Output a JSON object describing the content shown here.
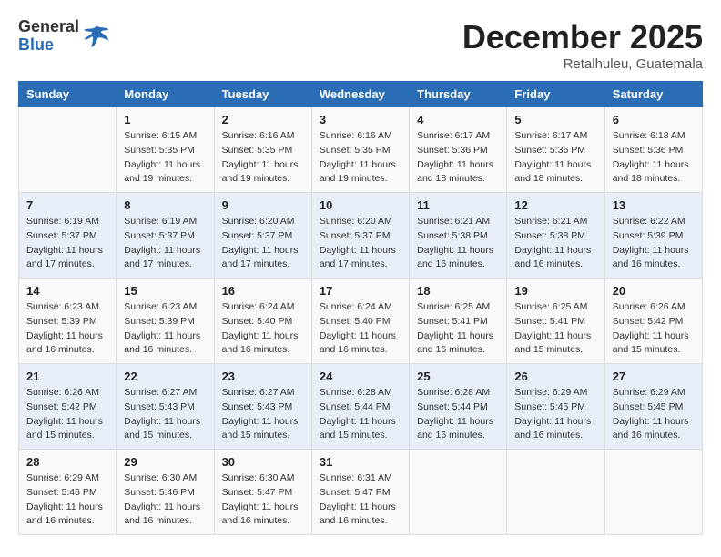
{
  "header": {
    "logo_general": "General",
    "logo_blue": "Blue",
    "month_title": "December 2025",
    "subtitle": "Retalhuleu, Guatemala"
  },
  "days_of_week": [
    "Sunday",
    "Monday",
    "Tuesday",
    "Wednesday",
    "Thursday",
    "Friday",
    "Saturday"
  ],
  "weeks": [
    [
      {
        "day": "",
        "info": ""
      },
      {
        "day": "1",
        "info": "Sunrise: 6:15 AM\nSunset: 5:35 PM\nDaylight: 11 hours and 19 minutes."
      },
      {
        "day": "2",
        "info": "Sunrise: 6:16 AM\nSunset: 5:35 PM\nDaylight: 11 hours and 19 minutes."
      },
      {
        "day": "3",
        "info": "Sunrise: 6:16 AM\nSunset: 5:35 PM\nDaylight: 11 hours and 19 minutes."
      },
      {
        "day": "4",
        "info": "Sunrise: 6:17 AM\nSunset: 5:36 PM\nDaylight: 11 hours and 18 minutes."
      },
      {
        "day": "5",
        "info": "Sunrise: 6:17 AM\nSunset: 5:36 PM\nDaylight: 11 hours and 18 minutes."
      },
      {
        "day": "6",
        "info": "Sunrise: 6:18 AM\nSunset: 5:36 PM\nDaylight: 11 hours and 18 minutes."
      }
    ],
    [
      {
        "day": "7",
        "info": "Sunrise: 6:19 AM\nSunset: 5:37 PM\nDaylight: 11 hours and 17 minutes."
      },
      {
        "day": "8",
        "info": "Sunrise: 6:19 AM\nSunset: 5:37 PM\nDaylight: 11 hours and 17 minutes."
      },
      {
        "day": "9",
        "info": "Sunrise: 6:20 AM\nSunset: 5:37 PM\nDaylight: 11 hours and 17 minutes."
      },
      {
        "day": "10",
        "info": "Sunrise: 6:20 AM\nSunset: 5:37 PM\nDaylight: 11 hours and 17 minutes."
      },
      {
        "day": "11",
        "info": "Sunrise: 6:21 AM\nSunset: 5:38 PM\nDaylight: 11 hours and 16 minutes."
      },
      {
        "day": "12",
        "info": "Sunrise: 6:21 AM\nSunset: 5:38 PM\nDaylight: 11 hours and 16 minutes."
      },
      {
        "day": "13",
        "info": "Sunrise: 6:22 AM\nSunset: 5:39 PM\nDaylight: 11 hours and 16 minutes."
      }
    ],
    [
      {
        "day": "14",
        "info": "Sunrise: 6:23 AM\nSunset: 5:39 PM\nDaylight: 11 hours and 16 minutes."
      },
      {
        "day": "15",
        "info": "Sunrise: 6:23 AM\nSunset: 5:39 PM\nDaylight: 11 hours and 16 minutes."
      },
      {
        "day": "16",
        "info": "Sunrise: 6:24 AM\nSunset: 5:40 PM\nDaylight: 11 hours and 16 minutes."
      },
      {
        "day": "17",
        "info": "Sunrise: 6:24 AM\nSunset: 5:40 PM\nDaylight: 11 hours and 16 minutes."
      },
      {
        "day": "18",
        "info": "Sunrise: 6:25 AM\nSunset: 5:41 PM\nDaylight: 11 hours and 16 minutes."
      },
      {
        "day": "19",
        "info": "Sunrise: 6:25 AM\nSunset: 5:41 PM\nDaylight: 11 hours and 15 minutes."
      },
      {
        "day": "20",
        "info": "Sunrise: 6:26 AM\nSunset: 5:42 PM\nDaylight: 11 hours and 15 minutes."
      }
    ],
    [
      {
        "day": "21",
        "info": "Sunrise: 6:26 AM\nSunset: 5:42 PM\nDaylight: 11 hours and 15 minutes."
      },
      {
        "day": "22",
        "info": "Sunrise: 6:27 AM\nSunset: 5:43 PM\nDaylight: 11 hours and 15 minutes."
      },
      {
        "day": "23",
        "info": "Sunrise: 6:27 AM\nSunset: 5:43 PM\nDaylight: 11 hours and 15 minutes."
      },
      {
        "day": "24",
        "info": "Sunrise: 6:28 AM\nSunset: 5:44 PM\nDaylight: 11 hours and 15 minutes."
      },
      {
        "day": "25",
        "info": "Sunrise: 6:28 AM\nSunset: 5:44 PM\nDaylight: 11 hours and 16 minutes."
      },
      {
        "day": "26",
        "info": "Sunrise: 6:29 AM\nSunset: 5:45 PM\nDaylight: 11 hours and 16 minutes."
      },
      {
        "day": "27",
        "info": "Sunrise: 6:29 AM\nSunset: 5:45 PM\nDaylight: 11 hours and 16 minutes."
      }
    ],
    [
      {
        "day": "28",
        "info": "Sunrise: 6:29 AM\nSunset: 5:46 PM\nDaylight: 11 hours and 16 minutes."
      },
      {
        "day": "29",
        "info": "Sunrise: 6:30 AM\nSunset: 5:46 PM\nDaylight: 11 hours and 16 minutes."
      },
      {
        "day": "30",
        "info": "Sunrise: 6:30 AM\nSunset: 5:47 PM\nDaylight: 11 hours and 16 minutes."
      },
      {
        "day": "31",
        "info": "Sunrise: 6:31 AM\nSunset: 5:47 PM\nDaylight: 11 hours and 16 minutes."
      },
      {
        "day": "",
        "info": ""
      },
      {
        "day": "",
        "info": ""
      },
      {
        "day": "",
        "info": ""
      }
    ]
  ]
}
